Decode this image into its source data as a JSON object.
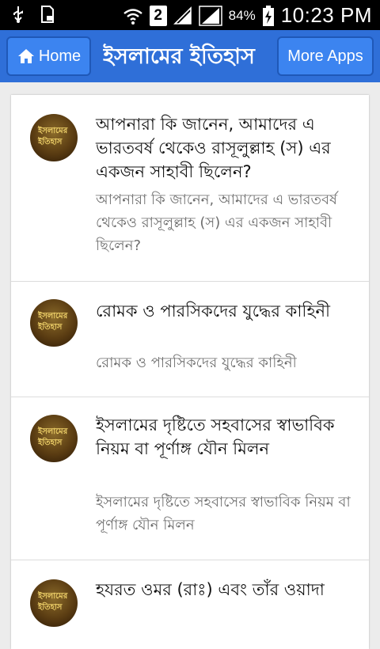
{
  "status_bar": {
    "battery_percent": "84%",
    "time": "10:23 PM",
    "icons": [
      "usb-icon",
      "sd-card-icon",
      "wifi-icon",
      "sim-2-icon",
      "signal-icon",
      "signal-full-icon",
      "battery-charging-icon"
    ],
    "sim_label": "2"
  },
  "header": {
    "home_label": "Home",
    "title": "ইসলামের ইতিহাস",
    "more_apps_label": "More Apps",
    "accent_color": "#2f6fd8"
  },
  "list": {
    "items": [
      {
        "title": "আপনারা কি জানেন, আমাদের এ ভারতবর্ষ থেকেও রাসূলুল্লাহ (স) এর একজন সাহাবী ছিলেন?",
        "subtitle": "আপনারা কি জানেন, আমাদের এ ভারতবর্ষ থেকেও রাসূলুল্লাহ (স) এর একজন সাহাবী ছিলেন?",
        "thumb_text": "ইসলামের ইতিহাস"
      },
      {
        "title": "রোমক ও পারসিকদের যুদ্ধের কাহিনী",
        "subtitle": "রোমক ও পারসিকদের যুদ্ধের কাহিনী",
        "thumb_text": "ইসলামের ইতিহাস"
      },
      {
        "title": "ইসলামের দৃষ্টিতে সহবাসের স্বাভাবিক নিয়ম বা পূর্ণাঙ্গ যৌন মিলন",
        "subtitle": "ইসলামের দৃষ্টিতে সহবাসের স্বাভাবিক নিয়ম বা পূর্ণাঙ্গ যৌন মিলন",
        "thumb_text": "ইসলামের ইতিহাস"
      },
      {
        "title": "হযরত ওমর (রাঃ) এবং তাঁর ওয়াদা",
        "subtitle": "",
        "thumb_text": "ইসলামের ইতিহাস"
      }
    ]
  }
}
